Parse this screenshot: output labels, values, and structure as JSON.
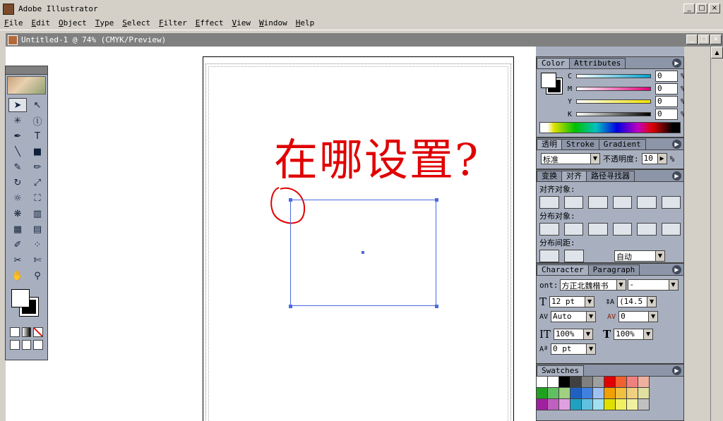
{
  "app": {
    "title": "Adobe Illustrator"
  },
  "menu": [
    "File",
    "Edit",
    "Object",
    "Type",
    "Select",
    "Filter",
    "Effect",
    "View",
    "Window",
    "Help"
  ],
  "document": {
    "title": "Untitled-1 @ 74% (CMYK/Preview)"
  },
  "canvas": {
    "annotation_text": "在哪设置?",
    "annotation_color": "#e00000",
    "selection_color": "#4a6adf"
  },
  "color_panel": {
    "tabs": [
      "Color",
      "Attributes"
    ],
    "channels": [
      {
        "label": "C",
        "value": "0",
        "unit": "%"
      },
      {
        "label": "M",
        "value": "0",
        "unit": "%"
      },
      {
        "label": "Y",
        "value": "0",
        "unit": "%"
      },
      {
        "label": "K",
        "value": "0",
        "unit": "%"
      }
    ]
  },
  "transparency_panel": {
    "tabs": [
      "透明",
      "Stroke",
      "Gradient"
    ],
    "mode": "标准",
    "opacity_label": "不透明度:",
    "opacity_value": "10",
    "unit": "%"
  },
  "align_panel": {
    "tabs": [
      "变换",
      "对齐",
      "路径寻找器"
    ],
    "align_objects_label": "对齐对象:",
    "distribute_objects_label": "分布对象:",
    "distribute_spacing_label": "分布间距:",
    "spacing_value": "自动"
  },
  "character_panel": {
    "tabs": [
      "Character",
      "Paragraph"
    ],
    "font_label": "ont:",
    "font_value": "方正北魏楷书",
    "font_style": "-",
    "size": "12 pt",
    "leading": "(14.5",
    "kerning": "Auto",
    "tracking": "0",
    "vscale": "100%",
    "hscale": "100%",
    "baseline": "0 pt"
  },
  "swatches_panel": {
    "tabs": [
      "Swatches"
    ]
  }
}
